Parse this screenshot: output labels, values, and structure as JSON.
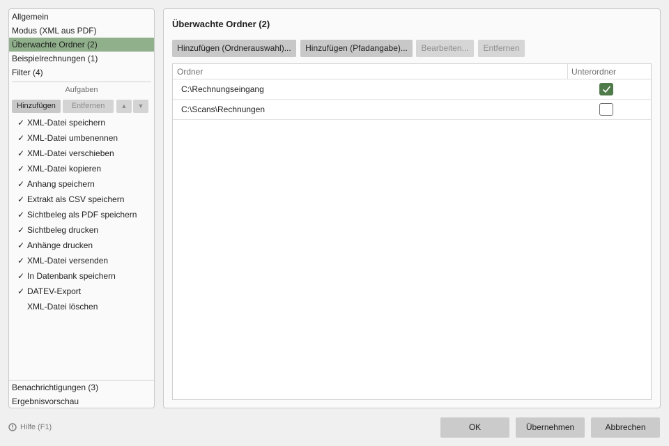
{
  "nav_top": [
    {
      "label": "Allgemein",
      "selected": false
    },
    {
      "label": "Modus (XML aus PDF)",
      "selected": false
    },
    {
      "label": "Überwachte Ordner (2)",
      "selected": true
    },
    {
      "label": "Beispielrechnungen (1)",
      "selected": false
    },
    {
      "label": "Filter (4)",
      "selected": false
    }
  ],
  "tasks": {
    "title": "Aufgaben",
    "add_label": "Hinzufügen",
    "remove_label": "Entfernen",
    "up_icon": "▲",
    "down_icon": "▼",
    "items": [
      {
        "label": "XML-Datei speichern",
        "checked": true
      },
      {
        "label": "XML-Datei umbenennen",
        "checked": true
      },
      {
        "label": "XML-Datei verschieben",
        "checked": true
      },
      {
        "label": "XML-Datei kopieren",
        "checked": true
      },
      {
        "label": "Anhang speichern",
        "checked": true
      },
      {
        "label": "Extrakt als CSV speichern",
        "checked": true
      },
      {
        "label": "Sichtbeleg als PDF speichern",
        "checked": true
      },
      {
        "label": "Sichtbeleg drucken",
        "checked": true
      },
      {
        "label": "Anhänge drucken",
        "checked": true
      },
      {
        "label": "XML-Datei versenden",
        "checked": true
      },
      {
        "label": "In Datenbank speichern",
        "checked": true
      },
      {
        "label": "DATEV-Export",
        "checked": true
      },
      {
        "label": "XML-Datei löschen",
        "checked": false
      }
    ],
    "check_glyph": "✓"
  },
  "nav_bottom": [
    {
      "label": "Benachrichtigungen (3)"
    },
    {
      "label": "Ergebnisvorschau"
    }
  ],
  "main": {
    "title": "Überwachte Ordner (2)",
    "buttons": {
      "add_folder": "Hinzufügen (Ordnerauswahl)...",
      "add_path": "Hinzufügen (Pfadangabe)...",
      "edit": "Bearbeiten...",
      "remove": "Entfernen"
    },
    "table": {
      "columns": [
        "Ordner",
        "Unterordner"
      ],
      "rows": [
        {
          "path": "C:\\Rechnungseingang",
          "subfolders": true
        },
        {
          "path": "C:\\Scans\\Rechnungen",
          "subfolders": false
        }
      ]
    }
  },
  "footer": {
    "help_label": "Hilfe (F1)",
    "ok_label": "OK",
    "apply_label": "Übernehmen",
    "cancel_label": "Abbrechen"
  },
  "colors": {
    "selected_bg": "#8fb08a",
    "checkbox_checked": "#4f7a4a"
  }
}
